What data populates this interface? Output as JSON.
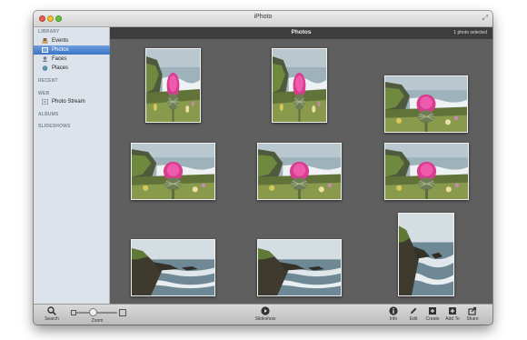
{
  "window": {
    "title": "iPhoto"
  },
  "sidebar": {
    "sections": [
      {
        "label": "LIBRARY"
      },
      {
        "label": "RECENT"
      },
      {
        "label": "WEB"
      },
      {
        "label": "ALBUMS"
      },
      {
        "label": "SLIDESHOWS"
      }
    ],
    "items": [
      {
        "label": "Events",
        "icon": "events-icon"
      },
      {
        "label": "Photos",
        "icon": "photos-icon",
        "selected": true
      },
      {
        "label": "Faces",
        "icon": "faces-icon"
      },
      {
        "label": "Places",
        "icon": "places-icon"
      },
      {
        "label": "Photo Stream",
        "icon": "photo-stream-icon"
      }
    ]
  },
  "header": {
    "title": "Photos",
    "selection_status": "1 photo selected"
  },
  "photos": [
    {
      "subject": "thistle",
      "orientation": "portrait"
    },
    {
      "subject": "thistle",
      "orientation": "portrait"
    },
    {
      "subject": "thistle",
      "orientation": "landscape"
    },
    {
      "subject": "thistle",
      "orientation": "landscape"
    },
    {
      "subject": "thistle",
      "orientation": "landscape"
    },
    {
      "subject": "thistle",
      "orientation": "landscape"
    },
    {
      "subject": "coast",
      "orientation": "landscape"
    },
    {
      "subject": "coast",
      "orientation": "landscape"
    },
    {
      "subject": "coast",
      "orientation": "portrait",
      "selected": true
    }
  ],
  "toolbar": {
    "search": "Search",
    "zoom": "Zoom",
    "zoom_level": 0.4,
    "slideshow": "Slideshow",
    "info": "Info",
    "edit": "Edit",
    "create": "Create",
    "add_to": "Add To",
    "share": "Share"
  },
  "colors": {
    "selection": "#3c74c7",
    "background": "#5f5f5f",
    "sidebar": "#dde3ea"
  }
}
